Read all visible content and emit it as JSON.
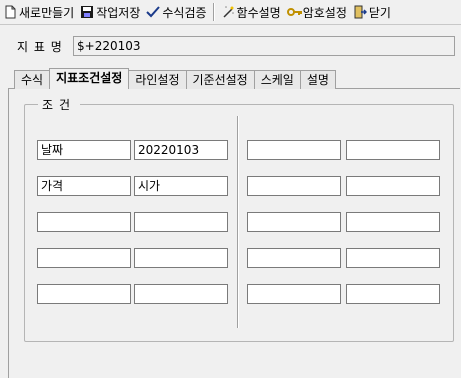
{
  "toolbar": {
    "new_label": "새로만들기",
    "save_label": "작업저장",
    "verify_label": "수식검증",
    "func_label": "함수설명",
    "pwd_label": "암호설정",
    "close_label": "닫기"
  },
  "indicator": {
    "label": "지 표 명",
    "value": "$+220103"
  },
  "tabs": [
    "수식",
    "지표조건설정",
    "라인설정",
    "기준선설정",
    "스케일",
    "설명"
  ],
  "active_tab": 1,
  "group": {
    "title": "조건"
  },
  "conditions": {
    "rows": [
      [
        "날짜",
        "20220103",
        "",
        ""
      ],
      [
        "가격",
        "시가",
        "",
        ""
      ],
      [
        "",
        "",
        "",
        ""
      ],
      [
        "",
        "",
        "",
        ""
      ],
      [
        "",
        "",
        "",
        ""
      ]
    ]
  }
}
